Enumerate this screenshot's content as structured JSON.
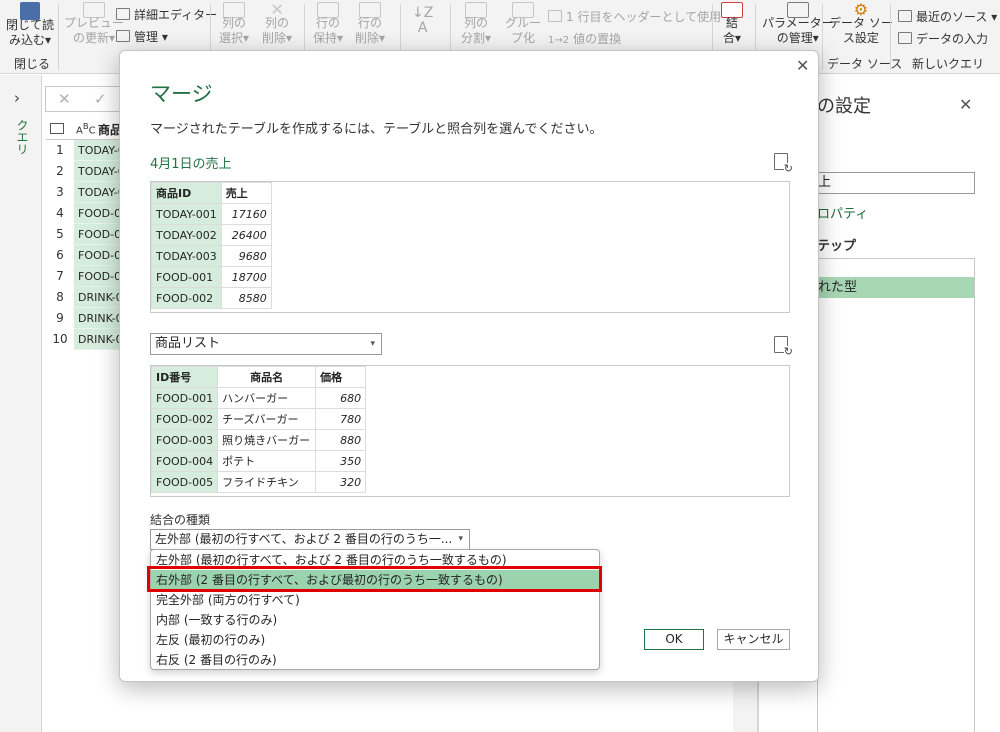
{
  "ribbon": {
    "close_load": "閉じて読\nみ込む▾",
    "preview_refresh": "プレビュー\nの更新▾",
    "advanced_editor": "詳細エディター",
    "manage": "管理 ▾",
    "choose_columns": "列の\n選択▾",
    "remove_columns": "列の\n削除▾",
    "keep_rows": "行の\n保持▾",
    "remove_rows": "行の\n削除▾",
    "split_column": "列の\n分割▾",
    "group_by": "グルー\nプ化",
    "use_header": "1 行目をヘッダーとして使用 ▾",
    "replace_values": "値の置換",
    "combine": "結\n合▾",
    "parameters": "パラメーター\nの管理▾",
    "data_source": "データ ソー\nス設定",
    "recent_sources": "最近のソース ▾",
    "enter_data": "データの入力",
    "group_close": "閉じる",
    "group_data_source": "データ ソース",
    "group_new_query": "新しいクエリ"
  },
  "left_nav": {
    "label": "クエリ"
  },
  "bg_table": {
    "header": "商品",
    "rows": [
      {
        "num": "1",
        "val": "TODAY-0"
      },
      {
        "num": "2",
        "val": "TODAY-0"
      },
      {
        "num": "3",
        "val": "TODAY-0"
      },
      {
        "num": "4",
        "val": "FOOD-00"
      },
      {
        "num": "5",
        "val": "FOOD-00"
      },
      {
        "num": "6",
        "val": "FOOD-00"
      },
      {
        "num": "7",
        "val": "FOOD-00"
      },
      {
        "num": "8",
        "val": "DRINK-0"
      },
      {
        "num": "9",
        "val": "DRINK-0"
      },
      {
        "num": "10",
        "val": "DRINK-0"
      }
    ]
  },
  "right_panel": {
    "title": "の設定",
    "name_value": "上",
    "link": "ロパティ",
    "steps_label": "テップ",
    "selected_step": "れた型"
  },
  "dialog": {
    "title": "マージ",
    "description": "マージされたテーブルを作成するには、テーブルと照合列を選んでください。",
    "table1_label": "4月1日の売上",
    "table1": {
      "headers": [
        "商品ID",
        "売上"
      ],
      "rows": [
        [
          "TODAY-001",
          "17160"
        ],
        [
          "TODAY-002",
          "26400"
        ],
        [
          "TODAY-003",
          "9680"
        ],
        [
          "FOOD-001",
          "18700"
        ],
        [
          "FOOD-002",
          "8580"
        ]
      ]
    },
    "table2_select": "商品リスト",
    "table2": {
      "headers": [
        "ID番号",
        "商品名",
        "価格"
      ],
      "rows": [
        [
          "FOOD-001",
          "ハンバーガー",
          "680"
        ],
        [
          "FOOD-002",
          "チーズバーガー",
          "780"
        ],
        [
          "FOOD-003",
          "照り焼きバーガー",
          "880"
        ],
        [
          "FOOD-004",
          "ポテト",
          "350"
        ],
        [
          "FOOD-005",
          "フライドチキン",
          "320"
        ]
      ]
    },
    "join_label": "結合の種類",
    "join_selected": "左外部 (最初の行すべて、および 2 番目の行のうち一...",
    "join_options": [
      "左外部 (最初の行すべて、および 2 番目の行のうち一致するもの)",
      "右外部 (2 番目の行すべて、および最初の行のうち一致するもの)",
      "完全外部 (両方の行すべて)",
      "内部 (一致する行のみ)",
      "左反 (最初の行のみ)",
      "右反 (2 番目の行のみ)"
    ],
    "ok": "OK",
    "cancel": "キャンセル"
  },
  "colors": {
    "accent_green": "#217346",
    "key_column_fill": "#d6eddd",
    "selected_option": "#9bd3ae",
    "highlight_red": "#e00000"
  }
}
